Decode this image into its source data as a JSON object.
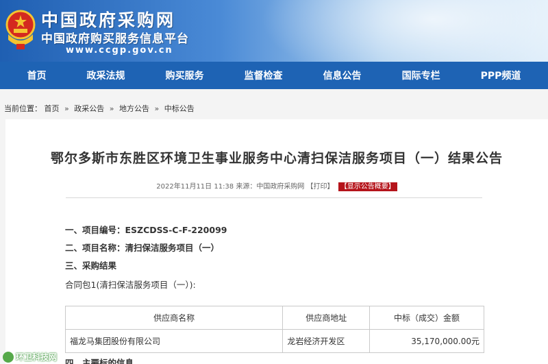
{
  "header": {
    "title": "中国政府采购网",
    "subtitle": "中国政府购买服务信息平台",
    "url": "www.ccgp.gov.cn"
  },
  "nav": {
    "items": [
      "首页",
      "政采法规",
      "购买服务",
      "监督检查",
      "信息公告",
      "国际专栏",
      "PPP频道"
    ]
  },
  "breadcrumb": {
    "prefix": "当前位置：",
    "items": [
      "首页",
      "政采公告",
      "地方公告",
      "中标公告"
    ],
    "separator": "»"
  },
  "notice": {
    "title": "鄂尔多斯市东胜区环境卫生事业服务中心清扫保洁服务项目（一）结果公告",
    "date": "2022年11月11日 11:38",
    "source": "来源：中国政府采购网",
    "print_label": "【打印】",
    "summary_label": "【显示公告概要】",
    "line1": "一、项目编号：ESZCDSS-C-F-220099",
    "line2": "二、项目名称：清扫保洁服务项目（一）",
    "line3": "三、采购结果",
    "package": "合同包1(清扫保洁服务项目（一）):",
    "line4": "四、主要标的信息"
  },
  "table": {
    "headers": [
      "供应商名称",
      "供应商地址",
      "中标（成交）金额"
    ],
    "rows": [
      [
        "福龙马集团股份有限公司",
        "龙岩经济开发区",
        "35,170,000.00元"
      ]
    ]
  },
  "watermark": {
    "text": "环卫科技网"
  },
  "colors": {
    "nav_bg": "#1e63b4",
    "accent_red": "#b5141b"
  }
}
